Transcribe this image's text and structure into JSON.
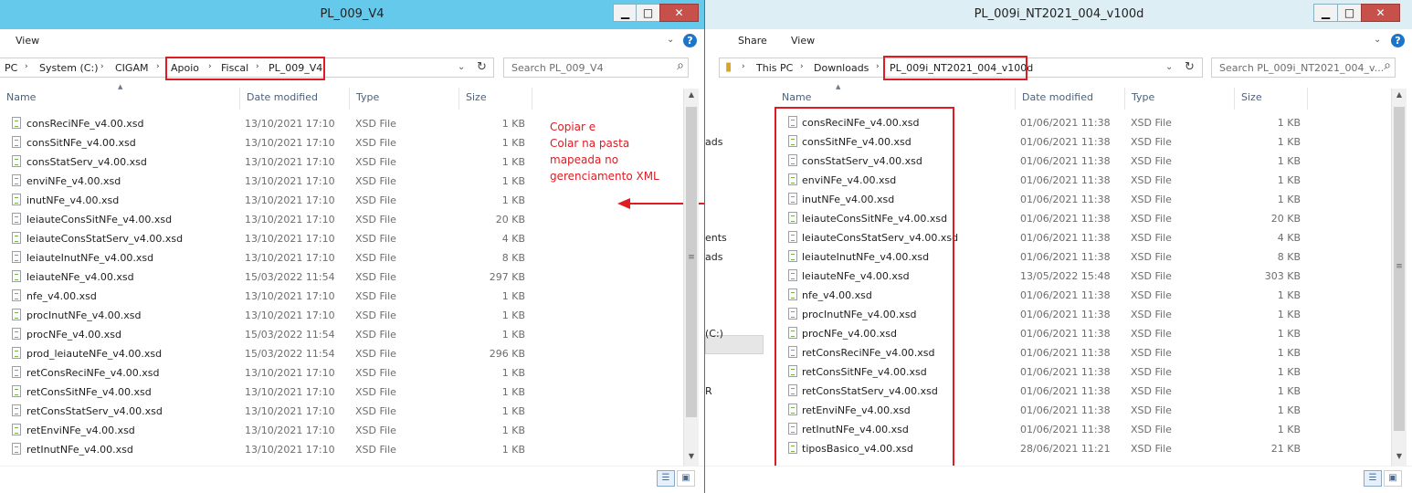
{
  "left": {
    "title": "PL_009_V4",
    "ribbon": {
      "view": "View"
    },
    "address": [
      "PC",
      "System (C:)",
      "CIGAM",
      "Apoio",
      "Fiscal",
      "PL_009_V4"
    ],
    "search_placeholder": "Search PL_009_V4",
    "columns": [
      "Name",
      "Date modified",
      "Type",
      "Size"
    ],
    "files": [
      {
        "name": "consReciNFe_v4.00.xsd",
        "date": "13/10/2021 17:10",
        "type": "XSD File",
        "size": "1 KB"
      },
      {
        "name": "consSitNFe_v4.00.xsd",
        "date": "13/10/2021 17:10",
        "type": "XSD File",
        "size": "1 KB"
      },
      {
        "name": "consStatServ_v4.00.xsd",
        "date": "13/10/2021 17:10",
        "type": "XSD File",
        "size": "1 KB"
      },
      {
        "name": "enviNFe_v4.00.xsd",
        "date": "13/10/2021 17:10",
        "type": "XSD File",
        "size": "1 KB"
      },
      {
        "name": "inutNFe_v4.00.xsd",
        "date": "13/10/2021 17:10",
        "type": "XSD File",
        "size": "1 KB"
      },
      {
        "name": "leiauteConsSitNFe_v4.00.xsd",
        "date": "13/10/2021 17:10",
        "type": "XSD File",
        "size": "20 KB"
      },
      {
        "name": "leiauteConsStatServ_v4.00.xsd",
        "date": "13/10/2021 17:10",
        "type": "XSD File",
        "size": "4 KB"
      },
      {
        "name": "leiauteInutNFe_v4.00.xsd",
        "date": "13/10/2021 17:10",
        "type": "XSD File",
        "size": "8 KB"
      },
      {
        "name": "leiauteNFe_v4.00.xsd",
        "date": "15/03/2022 11:54",
        "type": "XSD File",
        "size": "297 KB"
      },
      {
        "name": "nfe_v4.00.xsd",
        "date": "13/10/2021 17:10",
        "type": "XSD File",
        "size": "1 KB"
      },
      {
        "name": "procInutNFe_v4.00.xsd",
        "date": "13/10/2021 17:10",
        "type": "XSD File",
        "size": "1 KB"
      },
      {
        "name": "procNFe_v4.00.xsd",
        "date": "15/03/2022 11:54",
        "type": "XSD File",
        "size": "1 KB"
      },
      {
        "name": "prod_leiauteNFe_v4.00.xsd",
        "date": "15/03/2022 11:54",
        "type": "XSD File",
        "size": "296 KB"
      },
      {
        "name": "retConsReciNFe_v4.00.xsd",
        "date": "13/10/2021 17:10",
        "type": "XSD File",
        "size": "1 KB"
      },
      {
        "name": "retConsSitNFe_v4.00.xsd",
        "date": "13/10/2021 17:10",
        "type": "XSD File",
        "size": "1 KB"
      },
      {
        "name": "retConsStatServ_v4.00.xsd",
        "date": "13/10/2021 17:10",
        "type": "XSD File",
        "size": "1 KB"
      },
      {
        "name": "retEnviNFe_v4.00.xsd",
        "date": "13/10/2021 17:10",
        "type": "XSD File",
        "size": "1 KB"
      },
      {
        "name": "retInutNFe_v4.00.xsd",
        "date": "13/10/2021 17:10",
        "type": "XSD File",
        "size": "1 KB"
      }
    ]
  },
  "annotation": [
    "Copiar e",
    "Colar na pasta",
    "mapeada no",
    "gerenciamento XML"
  ],
  "right": {
    "title": "PL_009i_NT2021_004_v100d",
    "ribbon": {
      "share": "Share",
      "view": "View"
    },
    "address": [
      "This PC",
      "Downloads",
      "PL_009i_NT2021_004_v100d"
    ],
    "search_placeholder": "Search PL_009i_NT2021_004_v...",
    "columns": [
      "Name",
      "Date modified",
      "Type",
      "Size"
    ],
    "nav": [
      "ads",
      "ents",
      "ads",
      "(C:)",
      "R"
    ],
    "files": [
      {
        "name": "consReciNFe_v4.00.xsd",
        "date": "01/06/2021 11:38",
        "type": "XSD File",
        "size": "1 KB"
      },
      {
        "name": "consSitNFe_v4.00.xsd",
        "date": "01/06/2021 11:38",
        "type": "XSD File",
        "size": "1 KB"
      },
      {
        "name": "consStatServ_v4.00.xsd",
        "date": "01/06/2021 11:38",
        "type": "XSD File",
        "size": "1 KB"
      },
      {
        "name": "enviNFe_v4.00.xsd",
        "date": "01/06/2021 11:38",
        "type": "XSD File",
        "size": "1 KB"
      },
      {
        "name": "inutNFe_v4.00.xsd",
        "date": "01/06/2021 11:38",
        "type": "XSD File",
        "size": "1 KB"
      },
      {
        "name": "leiauteConsSitNFe_v4.00.xsd",
        "date": "01/06/2021 11:38",
        "type": "XSD File",
        "size": "20 KB"
      },
      {
        "name": "leiauteConsStatServ_v4.00.xsd",
        "date": "01/06/2021 11:38",
        "type": "XSD File",
        "size": "4 KB"
      },
      {
        "name": "leiauteInutNFe_v4.00.xsd",
        "date": "01/06/2021 11:38",
        "type": "XSD File",
        "size": "8 KB"
      },
      {
        "name": "leiauteNFe_v4.00.xsd",
        "date": "13/05/2022 15:48",
        "type": "XSD File",
        "size": "303 KB"
      },
      {
        "name": "nfe_v4.00.xsd",
        "date": "01/06/2021 11:38",
        "type": "XSD File",
        "size": "1 KB"
      },
      {
        "name": "procInutNFe_v4.00.xsd",
        "date": "01/06/2021 11:38",
        "type": "XSD File",
        "size": "1 KB"
      },
      {
        "name": "procNFe_v4.00.xsd",
        "date": "01/06/2021 11:38",
        "type": "XSD File",
        "size": "1 KB"
      },
      {
        "name": "retConsReciNFe_v4.00.xsd",
        "date": "01/06/2021 11:38",
        "type": "XSD File",
        "size": "1 KB"
      },
      {
        "name": "retConsSitNFe_v4.00.xsd",
        "date": "01/06/2021 11:38",
        "type": "XSD File",
        "size": "1 KB"
      },
      {
        "name": "retConsStatServ_v4.00.xsd",
        "date": "01/06/2021 11:38",
        "type": "XSD File",
        "size": "1 KB"
      },
      {
        "name": "retEnviNFe_v4.00.xsd",
        "date": "01/06/2021 11:38",
        "type": "XSD File",
        "size": "1 KB"
      },
      {
        "name": "retInutNFe_v4.00.xsd",
        "date": "01/06/2021 11:38",
        "type": "XSD File",
        "size": "1 KB"
      },
      {
        "name": "tiposBasico_v4.00.xsd",
        "date": "28/06/2021 11:21",
        "type": "XSD File",
        "size": "21 KB"
      }
    ]
  },
  "glyphs": {
    "minimize": "▁",
    "maximize": "□",
    "close": "✕",
    "separator": "›",
    "dropdown": "⌄",
    "refresh": "↻",
    "search": "⌕",
    "chevron": "⌄",
    "help": "?"
  },
  "colors": {
    "annotation": "#e01b22",
    "left_titlebar": "#65c9ec",
    "right_titlebar": "#ddeef5"
  }
}
